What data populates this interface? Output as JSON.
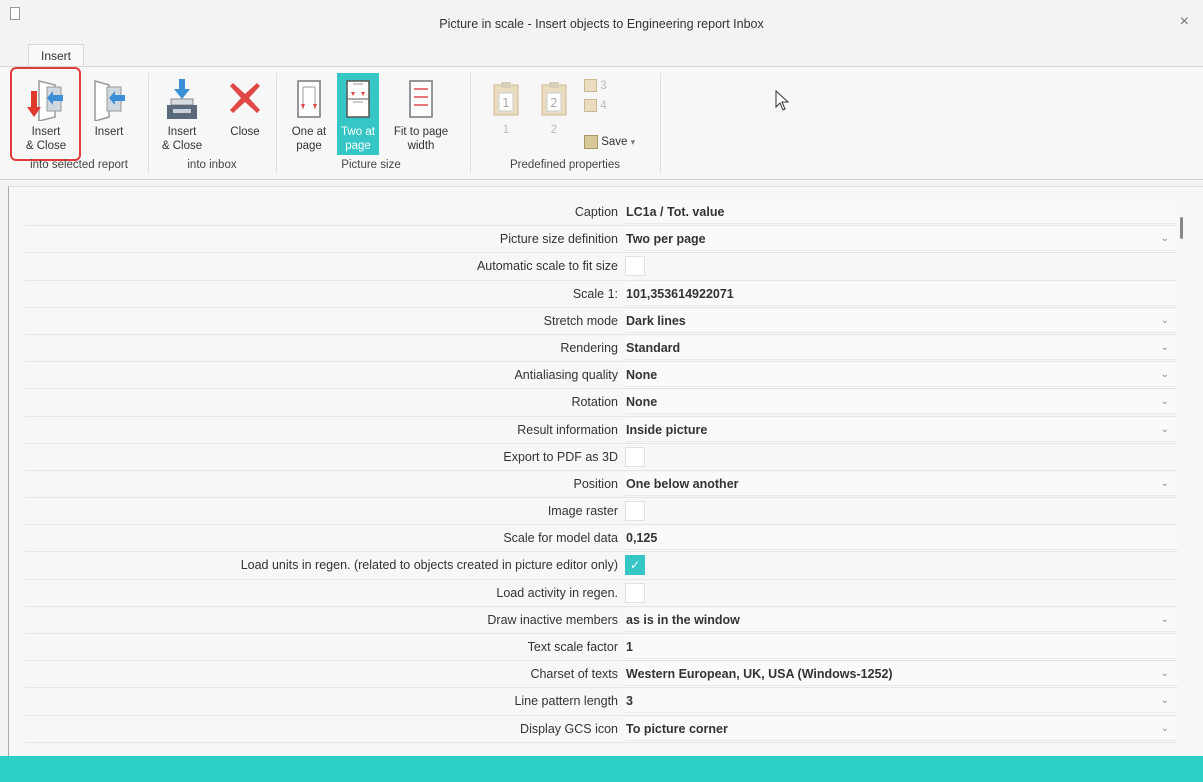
{
  "window": {
    "title": "Picture in scale - Insert objects to Engineering report Inbox",
    "close_symbol": "×"
  },
  "ribbon": {
    "tab": "Insert",
    "groups": {
      "selected_report": "into selected report",
      "inbox": "into inbox",
      "picture_size": "Picture size",
      "predefined": "Predefined properties"
    },
    "buttons": {
      "insert_close_1": "Insert",
      "insert_close_2": "& Close",
      "insert": "Insert",
      "inbox_insert_close_1": "Insert",
      "inbox_insert_close_2": "& Close",
      "close": "Close",
      "one_at_page_1": "One at",
      "one_at_page_2": "page",
      "two_at_page_1": "Two at",
      "two_at_page_2": "page",
      "fit_width_1": "Fit to page",
      "fit_width_2": "width",
      "preset_1": "1",
      "preset_2": "2",
      "preset_3": "3",
      "preset_4": "4",
      "save": "Save",
      "save_dropdown": "▾"
    }
  },
  "properties": [
    {
      "label": "Caption",
      "value": "LC1a / Tot. value",
      "type": "text"
    },
    {
      "label": "Picture size definition",
      "value": "Two per page",
      "type": "select"
    },
    {
      "label": "Automatic scale to fit size",
      "value": "",
      "type": "checkbox",
      "checked": false
    },
    {
      "label": "Scale 1:",
      "value": "101,353614922071",
      "type": "text"
    },
    {
      "label": "Stretch mode",
      "value": "Dark lines",
      "type": "select"
    },
    {
      "label": "Rendering",
      "value": "Standard",
      "type": "select"
    },
    {
      "label": "Antialiasing quality",
      "value": "None",
      "type": "select"
    },
    {
      "label": "Rotation",
      "value": "None",
      "type": "select"
    },
    {
      "label": "Result information",
      "value": "Inside picture",
      "type": "select"
    },
    {
      "label": "Export to PDF as 3D",
      "value": "",
      "type": "checkbox",
      "checked": false
    },
    {
      "label": "Position",
      "value": "One below another",
      "type": "select"
    },
    {
      "label": "Image raster",
      "value": "",
      "type": "checkbox",
      "checked": false
    },
    {
      "label": "Scale for model data",
      "value": "0,125",
      "type": "text"
    },
    {
      "label": "Load units in regen. (related to objects created in picture editor only)",
      "value": "",
      "type": "checkbox",
      "checked": true
    },
    {
      "label": "Load activity in regen.",
      "value": "",
      "type": "checkbox",
      "checked": false
    },
    {
      "label": "Draw inactive members",
      "value": "as is in the window",
      "type": "select"
    },
    {
      "label": "Text scale factor",
      "value": "1",
      "type": "text"
    },
    {
      "label": "Charset of texts",
      "value": "Western European, UK, USA (Windows-1252)",
      "type": "select"
    },
    {
      "label": "Line pattern length",
      "value": "3",
      "type": "select"
    },
    {
      "label": "Display GCS icon",
      "value": "To picture corner",
      "type": "select"
    }
  ],
  "colors": {
    "accent": "#36c6c6",
    "highlight": "#e23b3b",
    "bottom_bar": "#2ecfc6"
  }
}
